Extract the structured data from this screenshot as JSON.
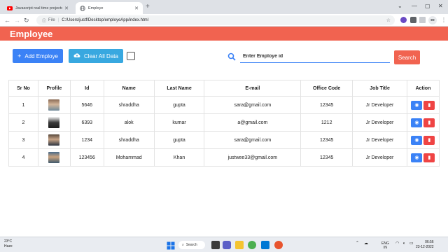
{
  "browser": {
    "tabs": [
      {
        "label": "Javascript real time projects - Yo"
      },
      {
        "label": "Employe"
      }
    ],
    "new_tab": "+",
    "window_controls": [
      "⌄",
      "—",
      "▢",
      "✕"
    ],
    "address": {
      "scheme": "File",
      "url": "C:/Users/justf/Desktop/employeApp/index.html"
    },
    "profile": "ee"
  },
  "app": {
    "title": "Employee",
    "add_button": "Add Employe",
    "clear_button": "Clear All Data",
    "search_placeholder": "Enter Employe id",
    "search_button": "Search"
  },
  "table": {
    "headers": [
      "Sr No",
      "Profile",
      "Id",
      "Name",
      "Last Name",
      "E-mail",
      "Office Code",
      "Job Title",
      "Action"
    ],
    "rows": [
      {
        "sr": "1",
        "id": "5646",
        "name": "shraddha",
        "last": "gupta",
        "email": "sara@gmail.com",
        "office": "12345",
        "job": "Jr Developer"
      },
      {
        "sr": "2",
        "id": "6393",
        "name": "alok",
        "last": "kumar",
        "email": "a@gmail.com",
        "office": "1212",
        "job": "Jr Developer"
      },
      {
        "sr": "3",
        "id": "1234",
        "name": "shraddha",
        "last": "gupta",
        "email": "sara@gmail.com",
        "office": "12345",
        "job": "Jr Developer"
      },
      {
        "sr": "4",
        "id": "123456",
        "name": "Mohammad",
        "last": "Khan",
        "email": "justwee33@gmail.com",
        "office": "12345",
        "job": "Jr Developer"
      }
    ]
  },
  "taskbar": {
    "weather_temp": "23°C",
    "weather_desc": "Haze",
    "search": "Search",
    "lang_line1": "ENG",
    "lang_line2": "IN",
    "time": "06:56",
    "date": "23-12-2022"
  },
  "colors": {
    "brand": "#f16350",
    "primary": "#3b82f6",
    "danger": "#ef4444",
    "clear": "#38a8e0"
  }
}
